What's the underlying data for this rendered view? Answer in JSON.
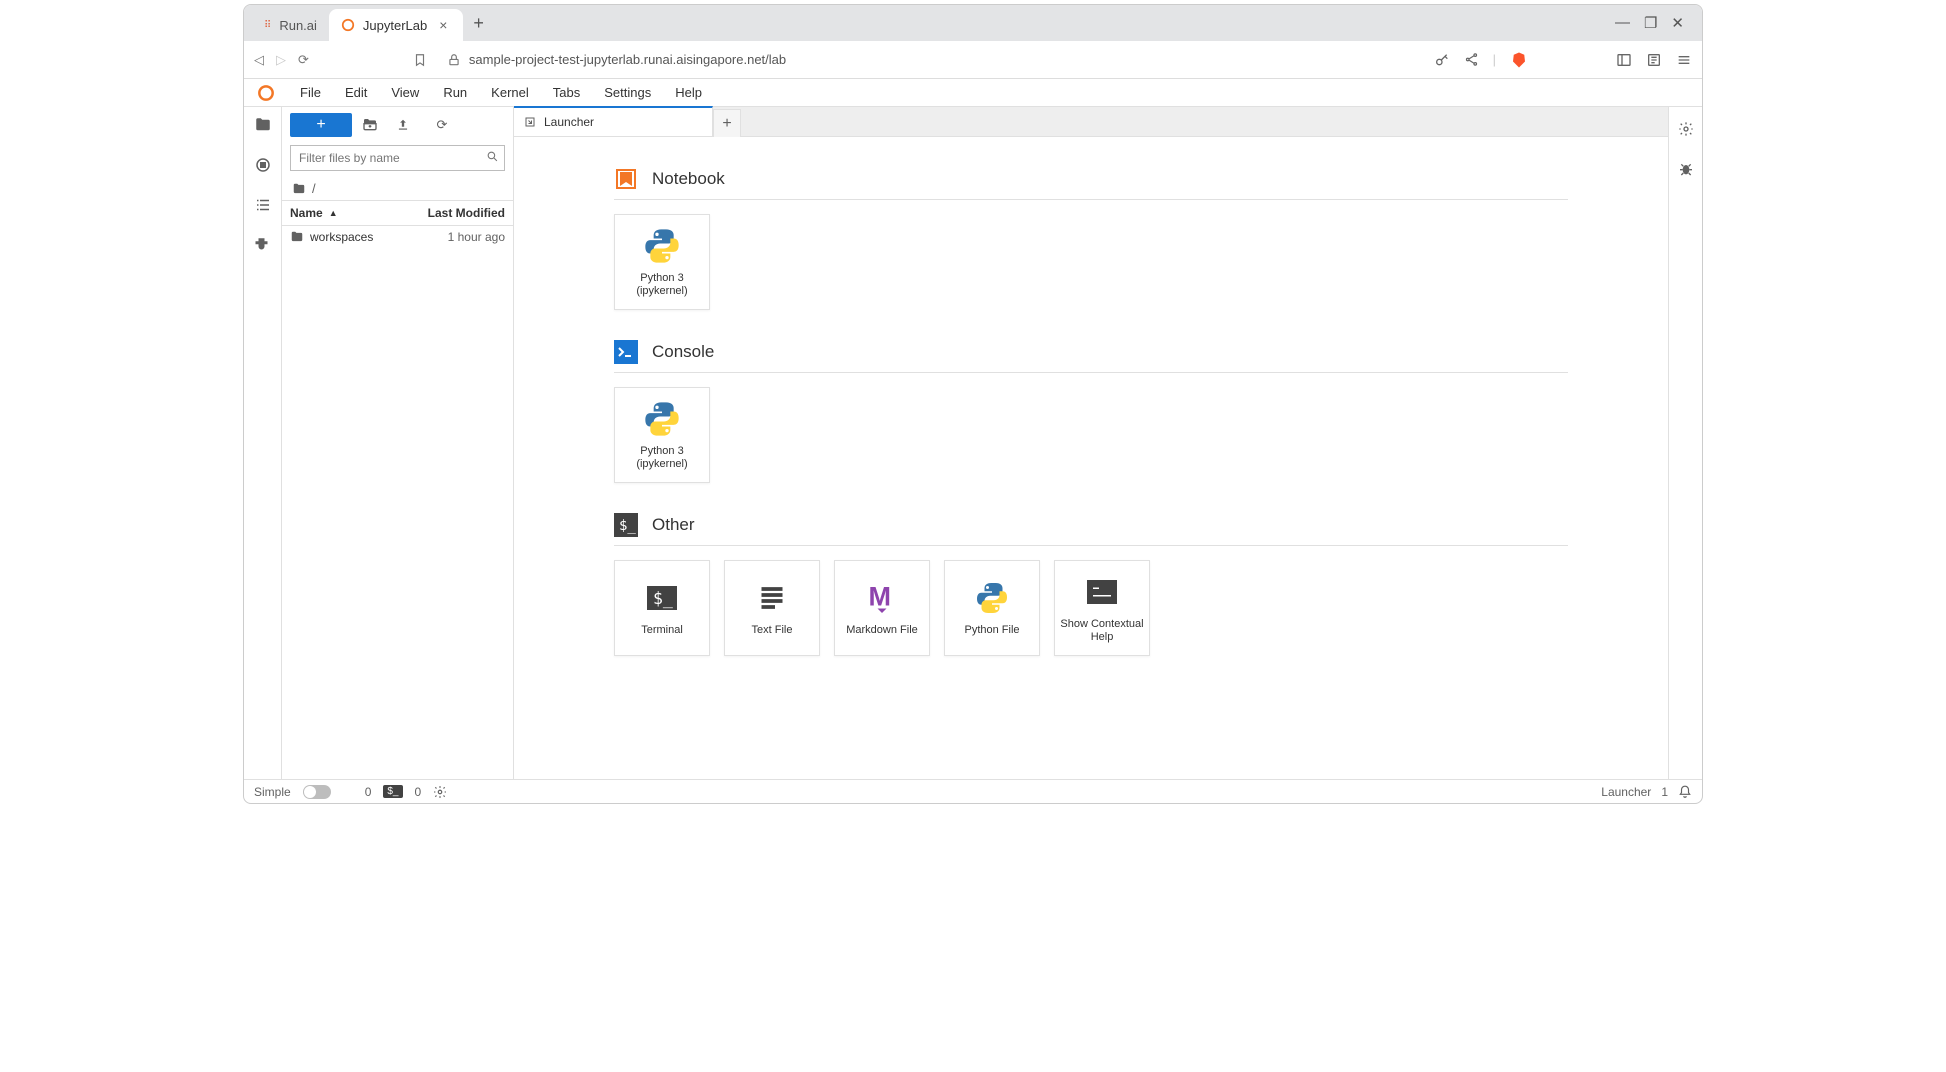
{
  "browser": {
    "tabs": [
      {
        "title": "Run.ai",
        "active": false
      },
      {
        "title": "JupyterLab",
        "active": true
      }
    ],
    "url": "sample-project-test-jupyterlab.runai.aisingapore.net/lab"
  },
  "menubar": [
    "File",
    "Edit",
    "View",
    "Run",
    "Kernel",
    "Tabs",
    "Settings",
    "Help"
  ],
  "filebrowser": {
    "filter_placeholder": "Filter files by name",
    "breadcrumb": "/",
    "columns": {
      "name": "Name",
      "modified": "Last Modified"
    },
    "items": [
      {
        "name": "workspaces",
        "modified": "1 hour ago",
        "type": "folder"
      }
    ]
  },
  "doc_tabs": {
    "active": "Launcher"
  },
  "launcher": {
    "sections": [
      {
        "title": "Notebook",
        "icon": "notebook",
        "cards": [
          {
            "label": "Python 3 (ipykernel)",
            "icon": "python"
          }
        ]
      },
      {
        "title": "Console",
        "icon": "console",
        "cards": [
          {
            "label": "Python 3 (ipykernel)",
            "icon": "python"
          }
        ]
      },
      {
        "title": "Other",
        "icon": "terminal",
        "cards": [
          {
            "label": "Terminal",
            "icon": "terminal"
          },
          {
            "label": "Text File",
            "icon": "textfile"
          },
          {
            "label": "Markdown File",
            "icon": "markdown"
          },
          {
            "label": "Python File",
            "icon": "python"
          },
          {
            "label": "Show Contextual Help",
            "icon": "help"
          }
        ]
      }
    ]
  },
  "statusbar": {
    "simple_label": "Simple",
    "term_count": "0",
    "kernel_count": "0",
    "right_label": "Launcher",
    "right_count": "1"
  }
}
